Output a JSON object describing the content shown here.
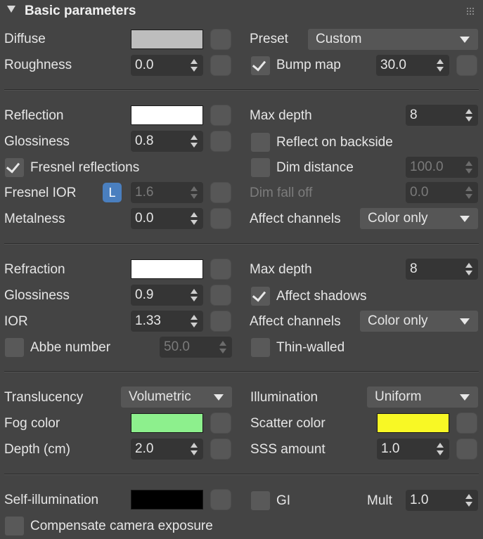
{
  "header": {
    "title": "Basic parameters"
  },
  "colors": {
    "panel_bg": "#444444",
    "diffuse": "#bdbdbd",
    "reflection": "#ffffff",
    "refraction": "#ffffff",
    "fog": "#8df08d",
    "scatter": "#f8f825",
    "self_illum": "#000000",
    "accent_L": "#4a7fbf"
  },
  "diffuse": {
    "label": "Diffuse",
    "preset_label": "Preset",
    "preset_value": "Custom",
    "roughness_label": "Roughness",
    "roughness_value": "0.0",
    "bump_label": "Bump map",
    "bump_checked": true,
    "bump_value": "30.0"
  },
  "reflection": {
    "label": "Reflection",
    "max_depth_label": "Max depth",
    "max_depth_value": "8",
    "glossiness_label": "Glossiness",
    "glossiness_value": "0.8",
    "reflect_backside_label": "Reflect on backside",
    "reflect_backside_checked": false,
    "fresnel_label": "Fresnel reflections",
    "fresnel_checked": true,
    "dim_distance_label": "Dim distance",
    "dim_distance_checked": false,
    "dim_distance_value": "100.0",
    "fresnel_ior_label": "Fresnel IOR",
    "lock_badge": "L",
    "fresnel_ior_value": "1.6",
    "dim_falloff_label": "Dim fall off",
    "dim_falloff_value": "0.0",
    "metalness_label": "Metalness",
    "metalness_value": "0.0",
    "affect_channels_label": "Affect channels",
    "affect_channels_value": "Color only"
  },
  "refraction": {
    "label": "Refraction",
    "max_depth_label": "Max depth",
    "max_depth_value": "8",
    "glossiness_label": "Glossiness",
    "glossiness_value": "0.9",
    "affect_shadows_label": "Affect shadows",
    "affect_shadows_checked": true,
    "ior_label": "IOR",
    "ior_value": "1.33",
    "affect_channels_label": "Affect channels",
    "affect_channels_value": "Color only",
    "abbe_label": "Abbe number",
    "abbe_checked": false,
    "abbe_value": "50.0",
    "thin_walled_label": "Thin-walled",
    "thin_walled_checked": false
  },
  "translucency": {
    "label": "Translucency",
    "value": "Volumetric",
    "illumination_label": "Illumination",
    "illumination_value": "Uniform",
    "fog_label": "Fog color",
    "scatter_label": "Scatter color",
    "depth_label": "Depth (cm)",
    "depth_value": "2.0",
    "sss_label": "SSS amount",
    "sss_value": "1.0"
  },
  "self_illumination": {
    "label": "Self-illumination",
    "gi_label": "GI",
    "gi_checked": false,
    "mult_label": "Mult",
    "mult_value": "1.0",
    "compensate_label": "Compensate camera exposure",
    "compensate_checked": false
  }
}
